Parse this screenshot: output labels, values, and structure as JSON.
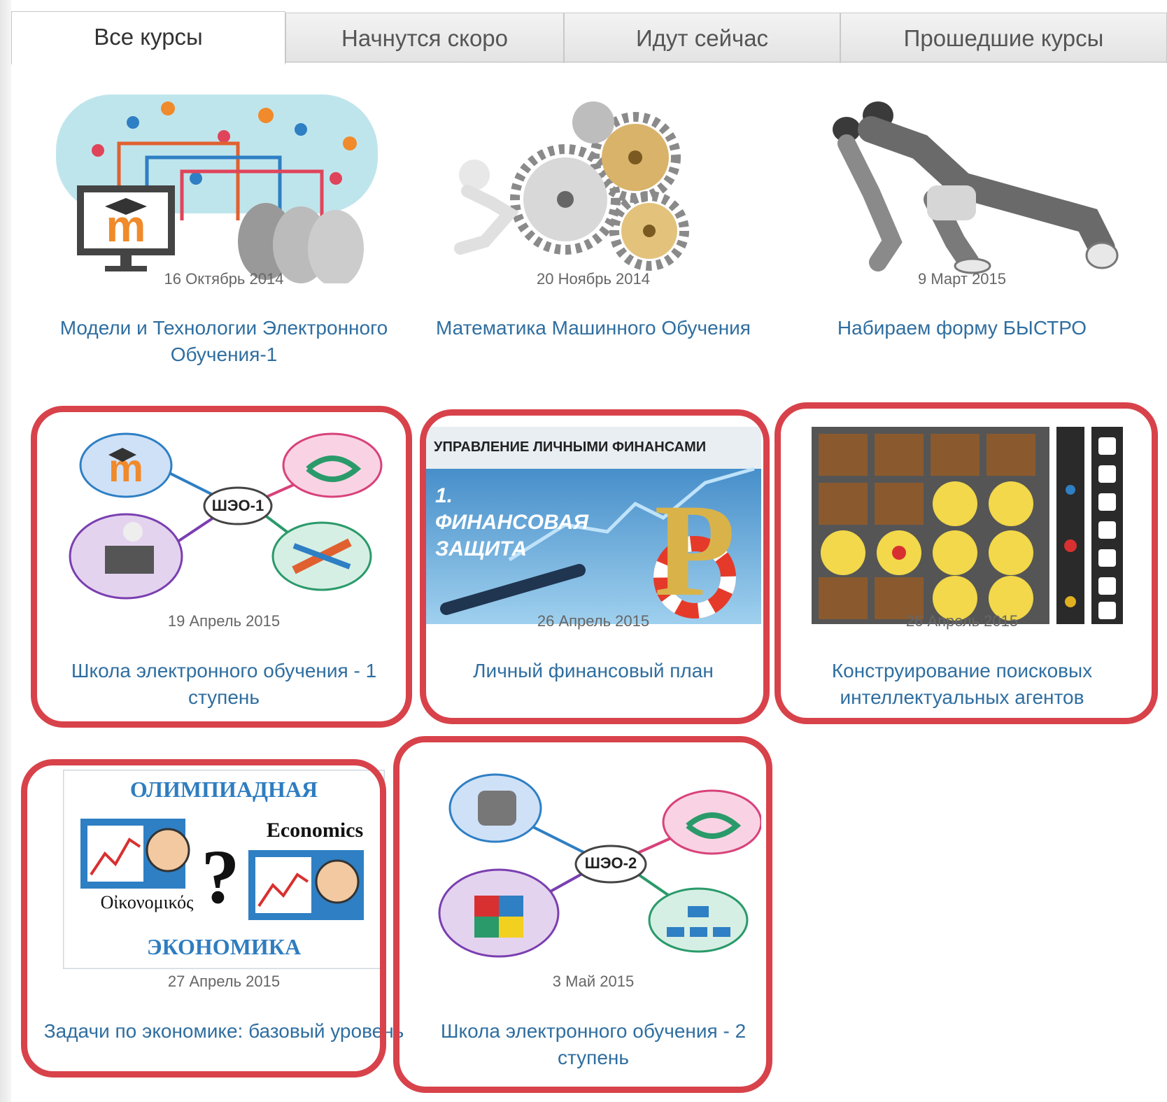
{
  "tabs": [
    {
      "label": "Все курсы",
      "active": true
    },
    {
      "label": "Начнутся скоро",
      "active": false
    },
    {
      "label": "Идут сейчас",
      "active": false
    },
    {
      "label": "Прошедшие курсы",
      "active": false
    }
  ],
  "courses": [
    {
      "date": "16 Октябрь 2014",
      "title": "Модели и Технологии Электронного Обучения-1"
    },
    {
      "date": "20 Ноябрь 2014",
      "title": "Математика Машинного Обучения"
    },
    {
      "date": "9 Март 2015",
      "title": "Набираем форму БЫСТРО"
    },
    {
      "date": "19 Апрель 2015",
      "title": "Школа электронного обучения - 1 ступень",
      "badge": "ШЭО-1"
    },
    {
      "date": "26 Апрель 2015",
      "title": "Личный финансовый план",
      "banner": "УПРАВЛЕНИЕ ЛИЧНЫМИ ФИНАНСАМИ",
      "subtitle": "1. ФИНАНСОВАЯ ЗАЩИТА"
    },
    {
      "date": "26 Апрель 2015",
      "title": "Конструирование поисковых интеллектуальных агентов"
    },
    {
      "date": "27 Апрель 2015",
      "title": "Задачи по экономике: базовый уровень",
      "top_word": "ОЛИМПИАДНАЯ",
      "bottom_word": "ЭКОНОМИКА",
      "word_en": "Economics",
      "word_gr": "Οἰκονομικός"
    },
    {
      "date": "3 Май 2015",
      "title": "Школа электронного обучения - 2 ступень",
      "badge": "ШЭО-2"
    }
  ],
  "colors": {
    "link": "#2f6ea0",
    "highlight": "#d8424a"
  }
}
